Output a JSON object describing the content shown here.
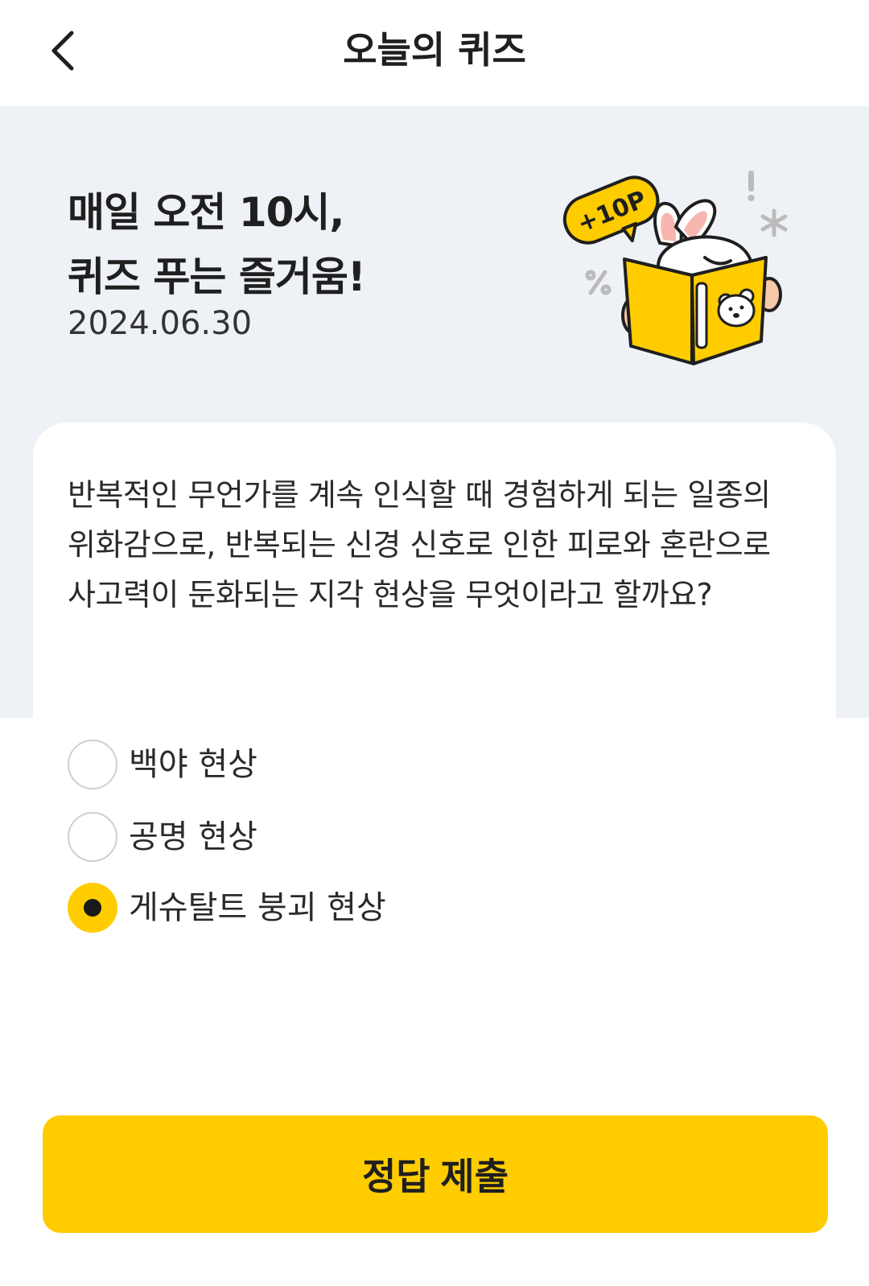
{
  "header": {
    "title": "오늘의 퀴즈",
    "back_icon": "chevron-left-icon"
  },
  "hero": {
    "title_line1": "매일 오전 10시,",
    "title_line2": "퀴즈 푸는 즐거움!",
    "date": "2024.06.30",
    "badge": "+10P"
  },
  "question": {
    "text": "반복적인 무언가를 계속 인식할 때 경험하게 되는 일종의 위화감으로, 반복되는 신경 신호로 인한 피로와 혼란으로 사고력이 둔화되는 지각 현상을 무엇이라고 할까요?"
  },
  "options": [
    {
      "label": "백야 현상",
      "selected": false
    },
    {
      "label": "공명 현상",
      "selected": false
    },
    {
      "label": "게슈탈트 붕괴 현상",
      "selected": true
    }
  ],
  "submit": {
    "label": "정답 제출"
  },
  "colors": {
    "accent": "#ffcc00",
    "hero_bg": "#eef1f6"
  }
}
